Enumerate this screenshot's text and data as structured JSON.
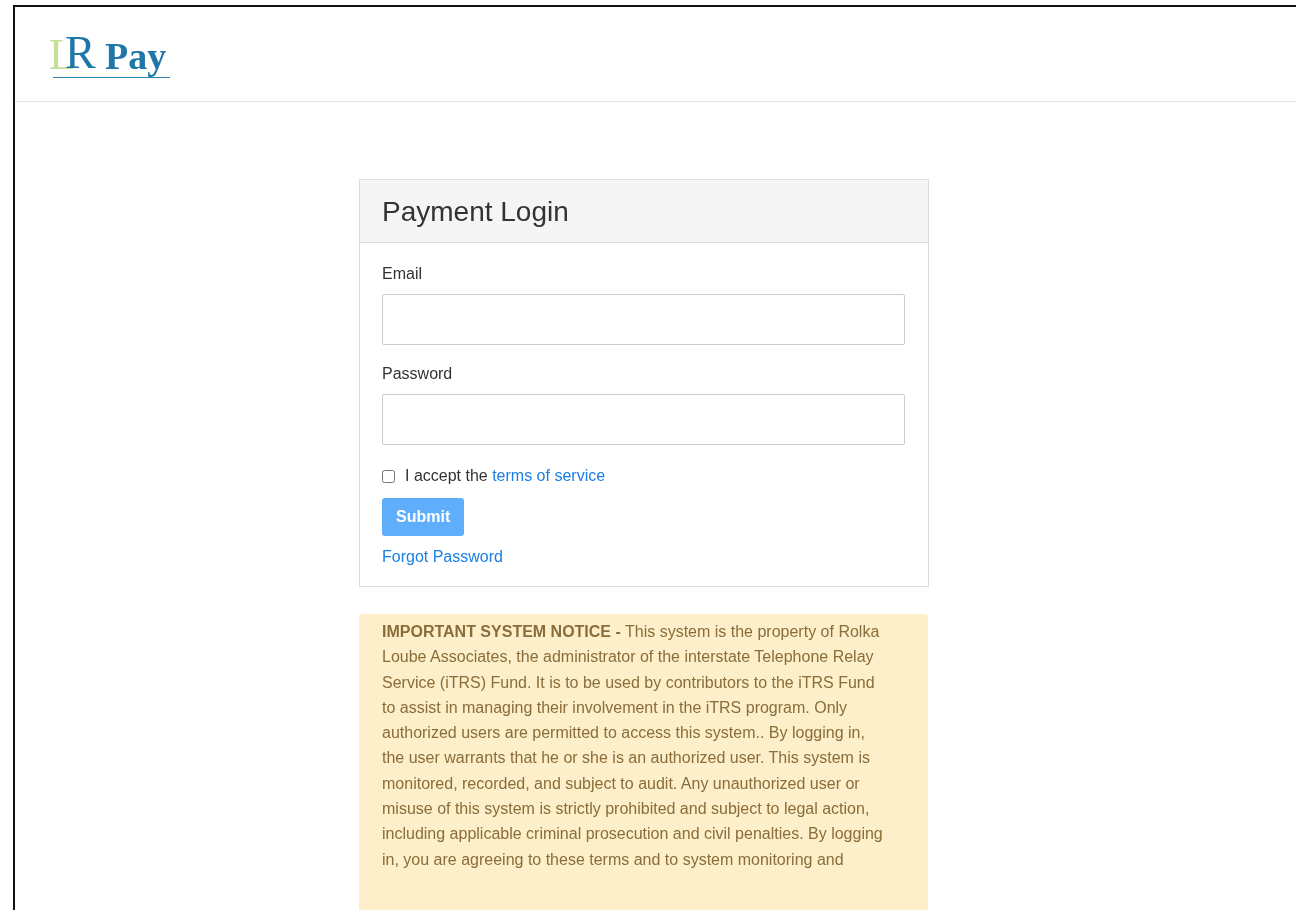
{
  "header": {
    "logo": {
      "monogram_back": "L",
      "monogram_front": "R",
      "name": "Pay"
    }
  },
  "login_panel": {
    "title": "Payment Login",
    "fields": [
      {
        "label": "Email"
      },
      {
        "label": "Password"
      }
    ],
    "terms": {
      "checked": false,
      "text": "I accept the",
      "link": "terms of service"
    },
    "submit": {
      "label": "Submit",
      "disabled": true
    },
    "forgot_link": "Forgot Password"
  },
  "notice": {
    "heading": "IMPORTANT SYSTEM NOTICE -",
    "text": "This system is the property of Rolka Loube Associates, the administrator of the interstate Telephone Relay Service (iTRS) Fund. It is to be used by contributors to the iTRS Fund to assist in managing their involvement in the iTRS program. Only authorized users are permitted to access this system.. By logging in, the user warrants that he or she is an authorized user. This system is monitored, recorded, and subject to audit. Any unauthorized user or misuse of this system is strictly prohibited and subject to legal action, including applicable criminal prosecution and civil penalties. By logging in, you are agreeing to these terms and to system monitoring and"
  }
}
